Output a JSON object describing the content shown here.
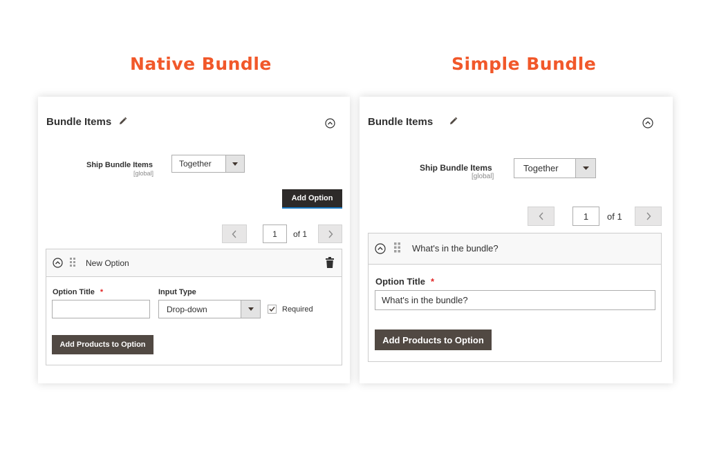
{
  "headings": {
    "left": "Native Bundle",
    "right": "Simple Bundle"
  },
  "native": {
    "title": "Bundle Items",
    "ship_label": "Ship Bundle Items",
    "ship_scope": "[global]",
    "ship_value": "Together",
    "add_option": "Add Option",
    "page_value": "1",
    "page_of": "of 1",
    "option_name": "New Option",
    "option_title_label": "Option Title",
    "required_mark": "*",
    "input_type_label": "Input Type",
    "input_type_value": "Drop-down",
    "required_label": "Required",
    "required_checked": true,
    "option_title_value": "",
    "add_products": "Add Products to Option"
  },
  "simple": {
    "title": "Bundle Items",
    "ship_label": "Ship Bundle Items",
    "ship_scope": "[global]",
    "ship_value": "Together",
    "page_value": "1",
    "page_of": "of 1",
    "option_name": "What's in the bundle?",
    "option_title_label": "Option Title",
    "required_mark": "*",
    "option_title_value": "What's in the bundle?",
    "add_products": "Add Products to Option"
  },
  "icons": [
    "pencil-icon",
    "collapse-icon",
    "chevron-left-icon",
    "chevron-right-icon",
    "drag-handle-icon",
    "trash-icon",
    "dropdown-arrow-icon",
    "checkbox-checked-icon"
  ],
  "colors": {
    "accent": "#f1582a",
    "button_dark": "#514943",
    "button_black": "#2d2a29",
    "required": "#e22626"
  }
}
